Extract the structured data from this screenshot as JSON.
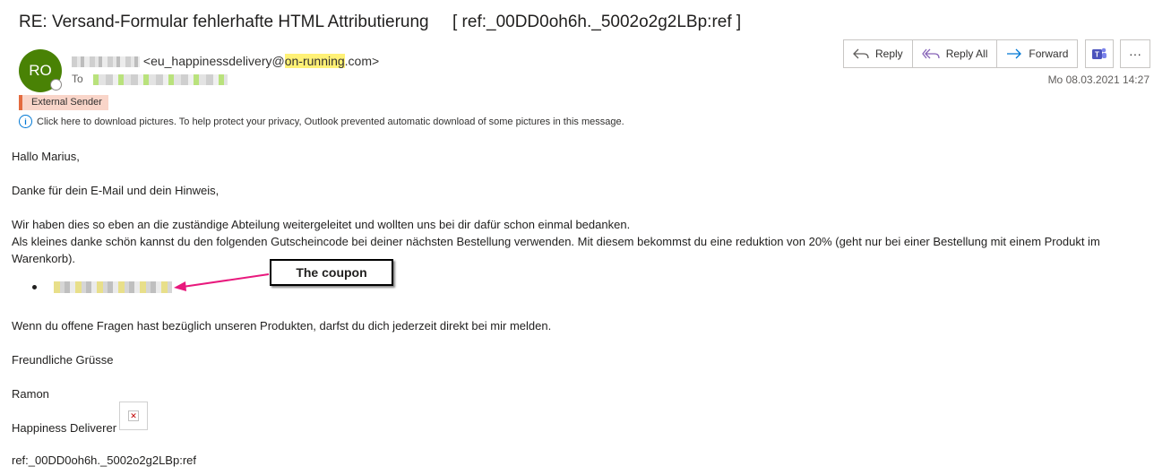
{
  "email": {
    "subject": "RE: Versand-Formular fehlerhafte HTML Attributierung     [ ref:_00DD0oh6h._5002o2g2LBp:ref ]",
    "sender_initials": "RO",
    "sender_address_prefix": "<eu_happinessdelivery@",
    "sender_address_highlight": "on-running",
    "sender_address_suffix": ".com>",
    "to_label": "To",
    "external_badge": "External Sender",
    "info_text": "Click here to download pictures. To help protect your privacy, Outlook prevented automatic download of some pictures in this message.",
    "date": "Mo 08.03.2021 14:27"
  },
  "actions": {
    "reply": "Reply",
    "reply_all": "Reply All",
    "forward": "Forward",
    "more": "···"
  },
  "body": {
    "greeting": "Hallo Marius,",
    "line1": "Danke für dein E-Mail und dein Hinweis,",
    "line2": "Wir haben dies so eben an die zuständige Abteilung weitergeleitet und wollten uns bei dir dafür schon einmal bedanken.",
    "line3a": "Als kleines danke schön kannst du den folgenden Gutscheincode bei deiner nächsten Bestellung verwenden. Mit diesem bekommst du eine reduktion von 20% (geht nur bei einer Bestellung mit einem Produkt im",
    "line3b": "Warenkorb).",
    "line4": "Wenn du offene Fragen hast bezüglich unseren Produkten, darfst du dich jederzeit direkt bei mir melden.",
    "closing": "Freundliche Grüsse",
    "name": "Ramon",
    "team": "Happiness Deliverer",
    "ref": "ref:_00DD0oh6h._5002o2g2LBp:ref"
  },
  "annotation": {
    "label": "The coupon",
    "arrow_color": "#e8197d"
  },
  "colors": {
    "avatar": "#498205",
    "accent": "#0078d4",
    "teams": "#4b53bc"
  }
}
